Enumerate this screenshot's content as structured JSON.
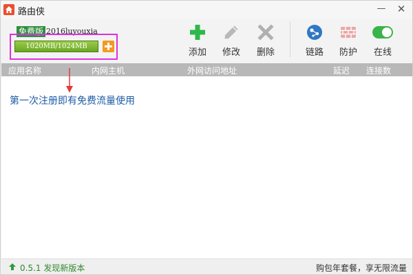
{
  "window": {
    "title": "路由侠",
    "minimize_icon": "minimize-icon",
    "close_icon": "close-icon"
  },
  "account": {
    "edition": "免费版",
    "username": "2016luyouxia"
  },
  "quota": {
    "text": "1020MB/1024MB",
    "used_fraction": 0.996,
    "add_icon": "plus-icon",
    "bar_color": "#7cb52e",
    "add_color": "#f39a1f"
  },
  "toolbar": {
    "add_label": "添加",
    "edit_label": "修改",
    "delete_label": "删除",
    "route_label": "链路",
    "protect_label": "防护",
    "online_label": "在线",
    "online_enabled": true,
    "add_color": "#2db84a",
    "toggle_color": "#3cb34a"
  },
  "table": {
    "columns": [
      "应用名称",
      "内网主机",
      "外网访问地址",
      "延迟",
      "连接数"
    ],
    "rows": []
  },
  "list": {
    "empty_hint": "第一次注册即有免费流量使用"
  },
  "status": {
    "version_text": "0.5.1 发现新版本",
    "promo_text": "购包年套餐，享无限流量"
  },
  "annotations": {
    "highlight_color": "#e12de1",
    "arrow_color": "#e23b3b"
  }
}
